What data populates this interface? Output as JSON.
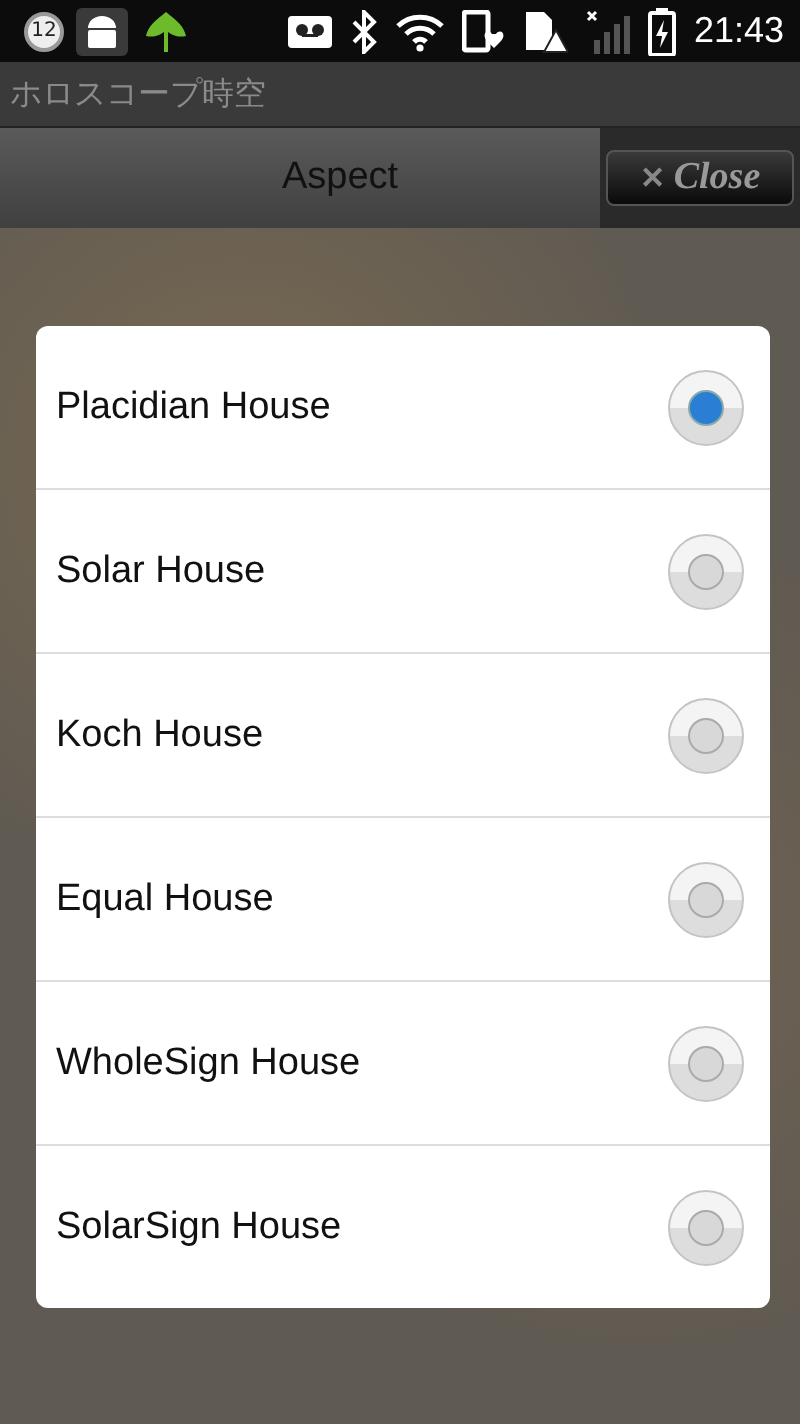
{
  "status_bar": {
    "notification_count": "12",
    "time": "21:43"
  },
  "app_title": "ホロスコープ時空",
  "header": {
    "title": "Aspect",
    "close_button": "Close",
    "close_glyph": "✕"
  },
  "dialog": {
    "options": [
      {
        "label": "Placidian House",
        "selected": true
      },
      {
        "label": "Solar House",
        "selected": false
      },
      {
        "label": "Koch House",
        "selected": false
      },
      {
        "label": "Equal House",
        "selected": false
      },
      {
        "label": "WholeSign House",
        "selected": false
      },
      {
        "label": "SolarSign House",
        "selected": false
      }
    ]
  }
}
